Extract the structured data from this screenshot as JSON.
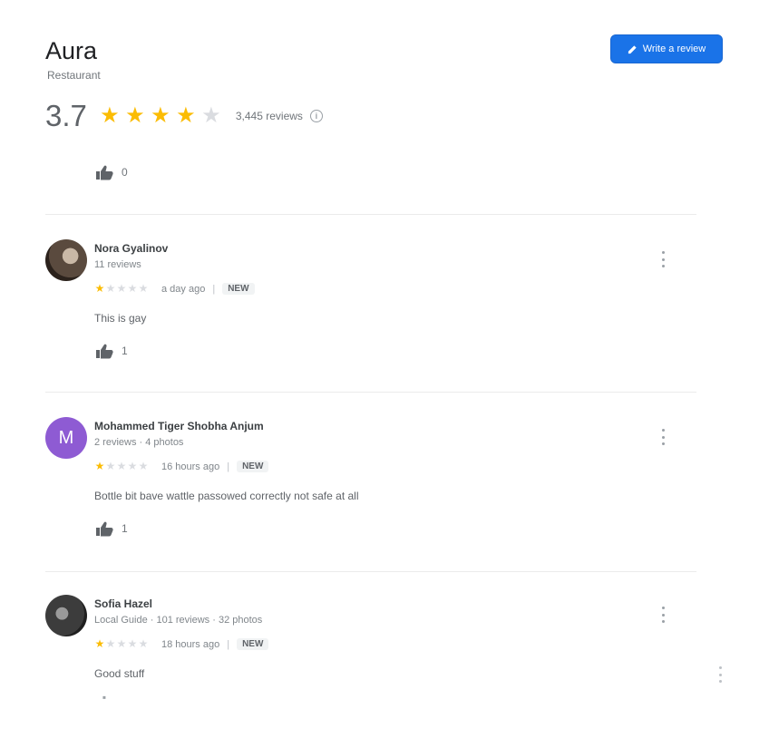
{
  "place": {
    "title": "Aura",
    "subtitle": "Restaurant",
    "rating": "3.7",
    "stars_filled": 4,
    "stars_total": 5,
    "review_count": "3,445 reviews"
  },
  "write_review": {
    "label": "Write a review"
  },
  "top_helpful_count": "0",
  "reviews": [
    {
      "name": "Nora Gyalinov",
      "meta": "11 reviews",
      "stars": 1,
      "time": "a day ago",
      "tag": "NEW",
      "text": "This is gay",
      "helpful_count": "1",
      "avatar_color": "#5a4a3e"
    },
    {
      "name": "Mohammed Tiger Shobha Anjum",
      "meta": "2 reviews · 4 photos",
      "stars": 1,
      "time": "16 hours ago",
      "tag": "NEW",
      "text": "Bottle bit bave wattle passowed correctly not safe at all",
      "helpful_count": "1",
      "avatar_letter": "M",
      "avatar_color": "#8e5bd3"
    },
    {
      "name": "Sofia Hazel",
      "meta": "Local Guide · 101 reviews · 32 photos",
      "stars": 1,
      "time": "18 hours ago",
      "tag": "NEW",
      "text": "Good stuff",
      "avatar_color": "#3c3c3c"
    }
  ],
  "colors": {
    "star_on": "#fbbc04",
    "star_off": "#dadce0",
    "primary_button": "#1a73e8"
  }
}
